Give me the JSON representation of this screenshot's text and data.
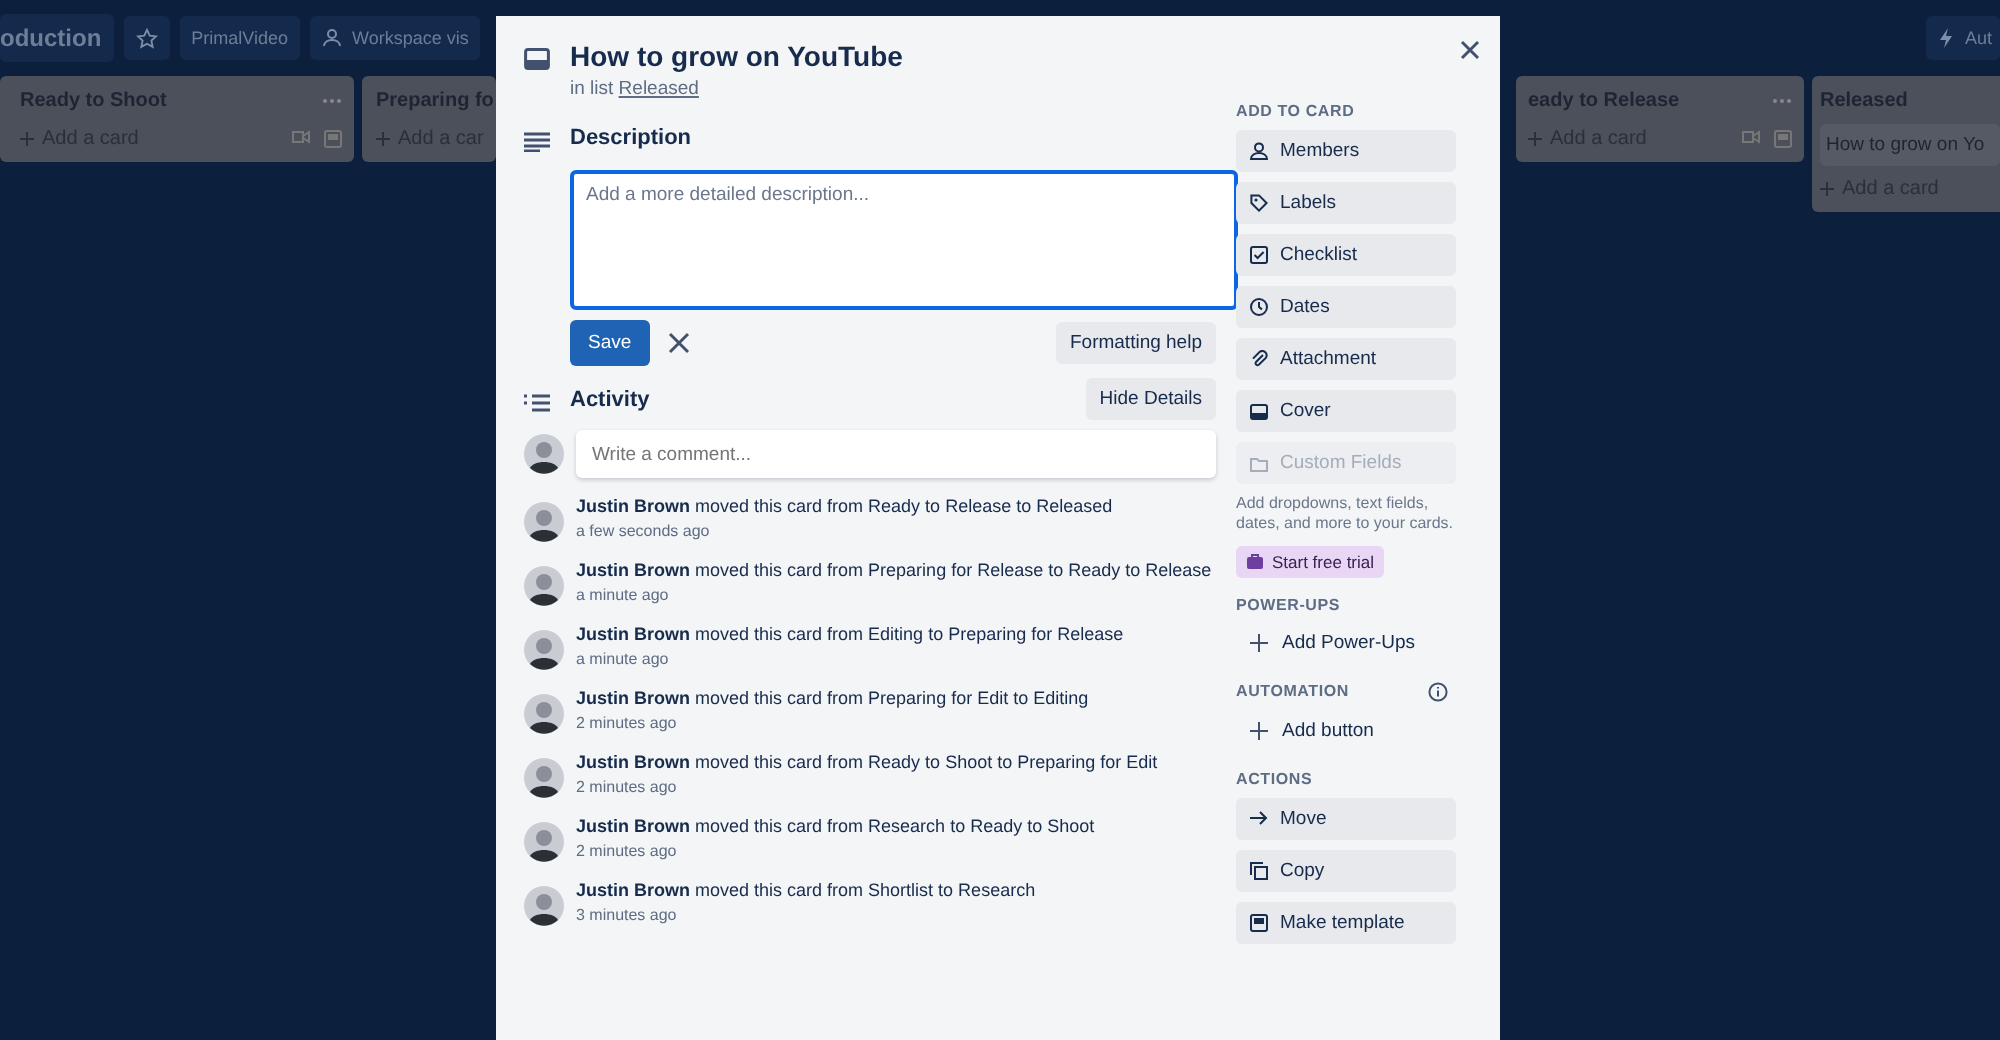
{
  "board": {
    "title": "oduction",
    "workspace": "PrimalVideo",
    "visibility": "Workspace vis",
    "automation": "Aut",
    "lists": [
      {
        "title": "Ready to Shoot",
        "add": "Add a card",
        "actions": true
      },
      {
        "title": "Preparing fo",
        "add": "Add a car",
        "actions": false
      },
      {
        "title": "eady to Release",
        "add": "Add a card",
        "actions": true
      },
      {
        "title": "Released",
        "add": "Add a card",
        "actions": false,
        "cards": [
          "How to grow on Yo"
        ]
      }
    ]
  },
  "modal": {
    "title": "How to grow on YouTube",
    "list_prefix": "in list",
    "list_link": "Released",
    "description": {
      "heading": "Description",
      "placeholder": "Add a more detailed description...",
      "save": "Save",
      "formatting_help": "Formatting help"
    },
    "activity": {
      "heading": "Activity",
      "hide_details": "Hide Details",
      "comment_placeholder": "Write a comment...",
      "items": [
        {
          "user": "Justin Brown",
          "text": "moved this card from Ready to Release to Released",
          "time": "a few seconds ago"
        },
        {
          "user": "Justin Brown",
          "text": "moved this card from Preparing for Release to Ready to Release",
          "time": "a minute ago"
        },
        {
          "user": "Justin Brown",
          "text": "moved this card from Editing to Preparing for Release",
          "time": "a minute ago"
        },
        {
          "user": "Justin Brown",
          "text": "moved this card from Preparing for Edit to Editing",
          "time": "2 minutes ago"
        },
        {
          "user": "Justin Brown",
          "text": "moved this card from Ready to Shoot to Preparing for Edit",
          "time": "2 minutes ago"
        },
        {
          "user": "Justin Brown",
          "text": "moved this card from Research to Ready to Shoot",
          "time": "2 minutes ago"
        },
        {
          "user": "Justin Brown",
          "text": "moved this card from Shortlist to Research",
          "time": "3 minutes ago"
        }
      ]
    },
    "sidebar": {
      "add_to_card": {
        "heading": "ADD TO CARD",
        "buttons": [
          {
            "label": "Members",
            "kind": "members",
            "disabled": false
          },
          {
            "label": "Labels",
            "kind": "labels",
            "disabled": false
          },
          {
            "label": "Checklist",
            "kind": "checklist",
            "disabled": false
          },
          {
            "label": "Dates",
            "kind": "dates",
            "disabled": false
          },
          {
            "label": "Attachment",
            "kind": "attachment",
            "disabled": false
          },
          {
            "label": "Cover",
            "kind": "cover",
            "disabled": false
          },
          {
            "label": "Custom Fields",
            "kind": "fields",
            "disabled": true
          }
        ],
        "promo": "Add dropdowns, text fields, dates, and more to your cards.",
        "trial": "Start free trial"
      },
      "power_ups": {
        "heading": "POWER-UPS",
        "button": "Add Power-Ups"
      },
      "automation": {
        "heading": "AUTOMATION",
        "button": "Add button"
      },
      "actions": {
        "heading": "ACTIONS",
        "buttons": [
          {
            "label": "Move",
            "kind": "move"
          },
          {
            "label": "Copy",
            "kind": "copy"
          },
          {
            "label": "Make template",
            "kind": "template"
          }
        ]
      }
    }
  }
}
